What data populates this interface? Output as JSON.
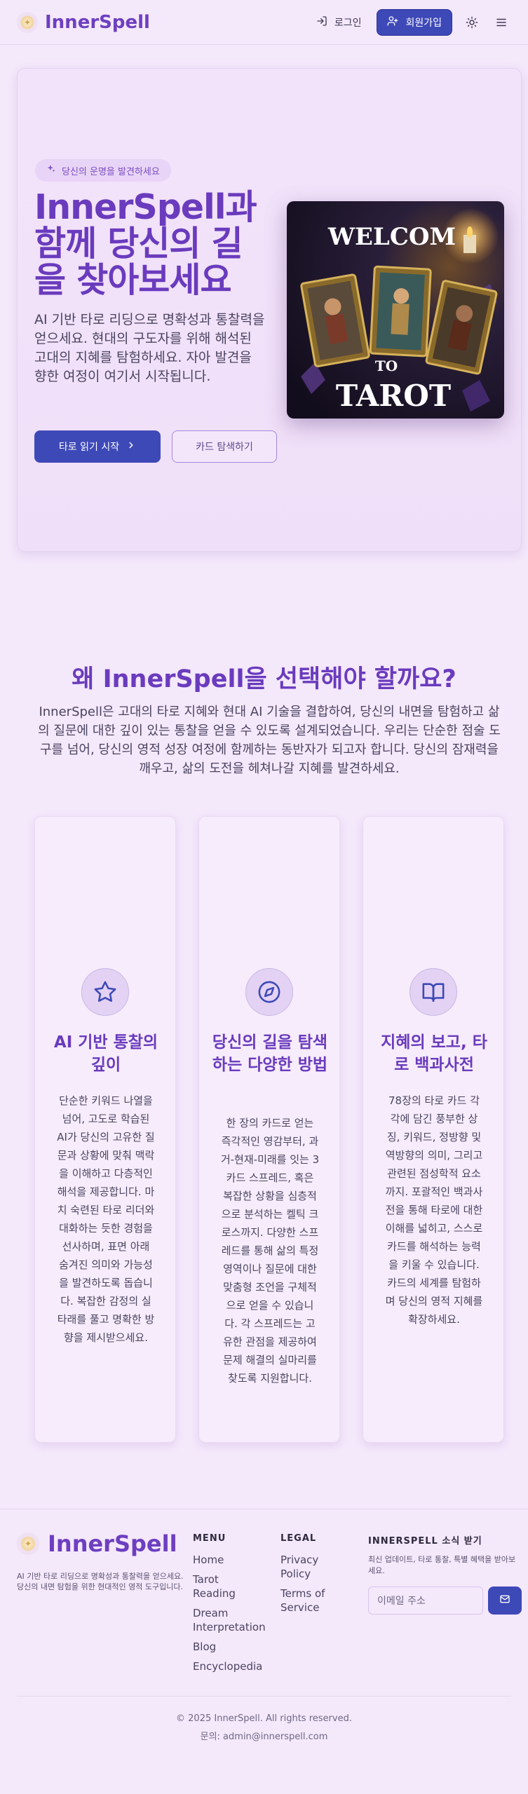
{
  "brand": {
    "name": "InnerSpell"
  },
  "header": {
    "login_label": "로그인",
    "signup_label": "회원가입"
  },
  "hero": {
    "badge": "당신의 운명을 발견하세요",
    "title": "InnerSpell과 함께 당신의 길을 찾아보세요",
    "description": "AI 기반 타로 리딩으로 명확성과 통찰력을 얻으세요. 현대의 구도자를 위해 해석된 고대의 지혜를 탐험하세요. 자아 발견을 향한 여정이 여기서 시작됩니다.",
    "primary_button": "타로 읽기 시작",
    "secondary_button": "카드 탐색하기",
    "image_text_top": "WELCOM",
    "image_text_mid": "TO",
    "image_text_bottom": "TAROT"
  },
  "why": {
    "title": "왜 InnerSpell을 선택해야 할까요?",
    "description": "InnerSpell은 고대의 타로 지혜와 현대 AI 기술을 결합하여, 당신의 내면을 탐험하고 삶의 질문에 대한 깊이 있는 통찰을 얻을 수 있도록 설계되었습니다. 우리는 단순한 점술 도구를 넘어, 당신의 영적 성장 여정에 함께하는 동반자가 되고자 합니다. 당신의 잠재력을 깨우고, 삶의 도전을 헤쳐나갈 지혜를 발견하세요."
  },
  "features": [
    {
      "icon": "star-icon",
      "title": "AI 기반 통찰의 깊이",
      "text": "단순한 키워드 나열을 넘어, 고도로 학습된 AI가 당신의 고유한 질문과 상황에 맞춰 맥락을 이해하고 다층적인 해석을 제공합니다. 마치 숙련된 타로 리더와 대화하는 듯한 경험을 선사하며, 표면 아래 숨겨진 의미와 가능성을 발견하도록 돕습니다. 복잡한 감정의 실타래를 풀고 명확한 방향을 제시받으세요."
    },
    {
      "icon": "compass-icon",
      "title": "당신의 길을 탐색하는 다양한 방법",
      "text": "한 장의 카드로 얻는 즉각적인 영감부터, 과거-현재-미래를 잇는 3카드 스프레드, 혹은 복잡한 상황을 심층적으로 분석하는 켈틱 크로스까지. 다양한 스프레드를 통해 삶의 특정 영역이나 질문에 대한 맞춤형 조언을 구체적으로 얻을 수 있습니다. 각 스프레드는 고유한 관점을 제공하여 문제 해결의 실마리를 찾도록 지원합니다."
    },
    {
      "icon": "book-open-icon",
      "title": "지혜의 보고, 타로 백과사전",
      "text": "78장의 타로 카드 각각에 담긴 풍부한 상징, 키워드, 정방향 및 역방향의 의미, 그리고 관련된 점성학적 요소까지. 포괄적인 백과사전을 통해 타로에 대한 이해를 넓히고, 스스로 카드를 해석하는 능력을 키울 수 있습니다. 카드의 세계를 탐험하며 당신의 영적 지혜를 확장하세요."
    }
  ],
  "footer": {
    "description": "AI 기반 타로 리딩으로 명확성과 통찰력을 얻으세요. 당신의 내면 탐험을 위한 현대적인 영적 도구입니다.",
    "menu_title": "MENU",
    "menu_items": [
      "Home",
      "Tarot Reading",
      "Dream Interpretation",
      "Blog",
      "Encyclopedia"
    ],
    "legal_title": "LEGAL",
    "legal_items": [
      "Privacy Policy",
      "Terms of Service"
    ],
    "news_title": "INNERSPELL 소식 받기",
    "news_desc": "최신 업데이트, 타로 통찰, 특별 혜택을 받아보세요.",
    "email_placeholder": "이메일 주소",
    "copyright": "© 2025 InnerSpell. All rights reserved.",
    "contact": "문의: admin@innerspell.com"
  }
}
